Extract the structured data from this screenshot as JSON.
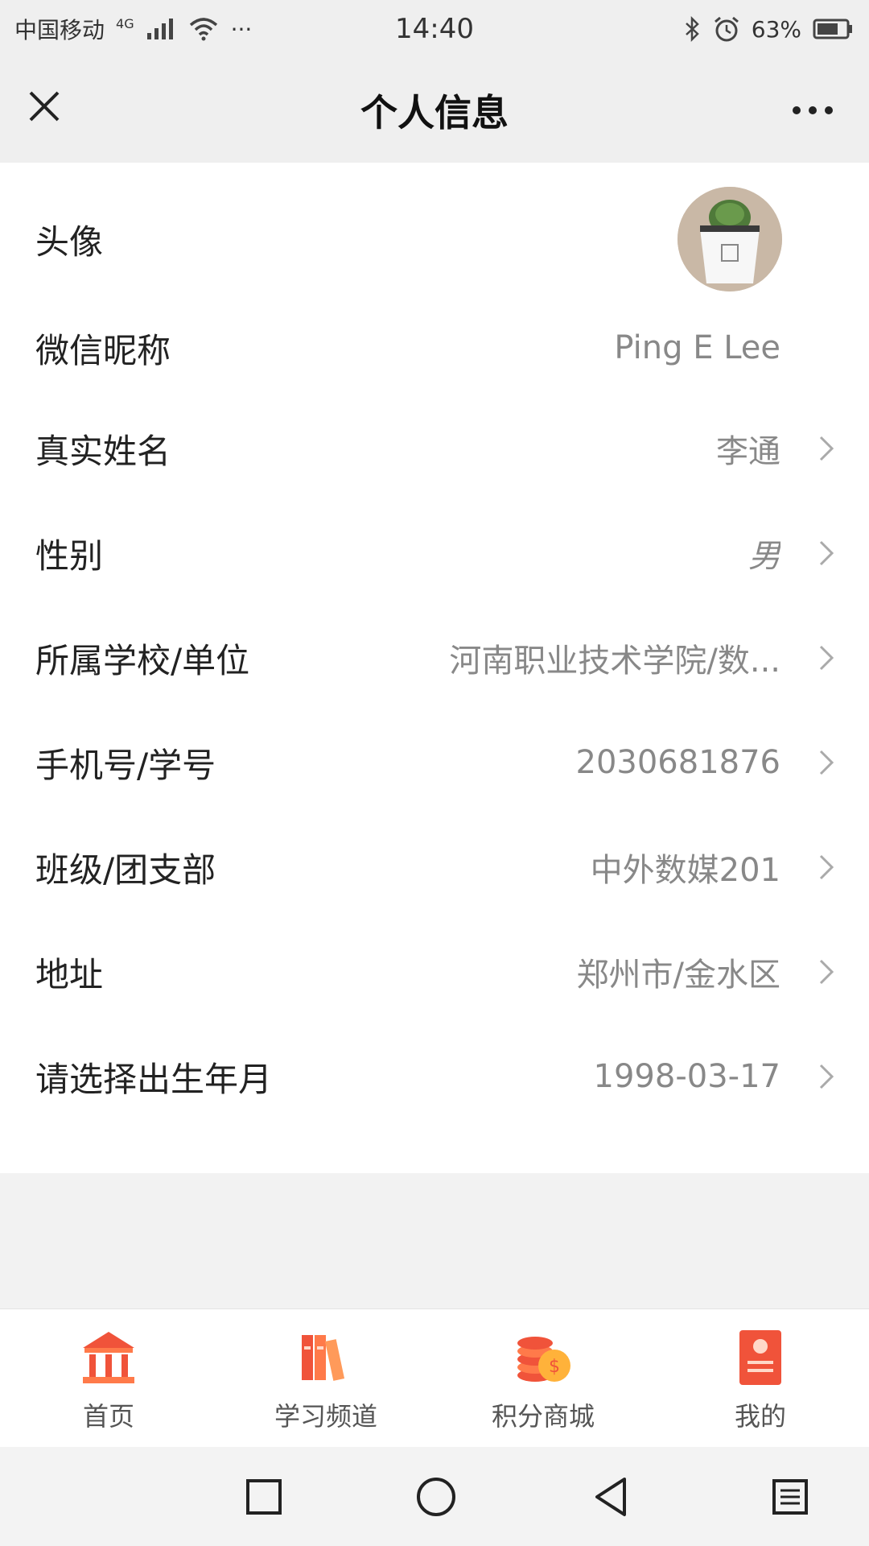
{
  "status": {
    "carrier": "中国移动",
    "network": "4G",
    "more": "···",
    "time": "14:40",
    "battery": "63%"
  },
  "nav": {
    "title": "个人信息"
  },
  "profile": {
    "avatar_label": "头像",
    "rows": [
      {
        "label": "微信昵称",
        "value": "Ping E Lee"
      },
      {
        "label": "真实姓名",
        "value": "李通"
      },
      {
        "label": "性别",
        "value": "男"
      },
      {
        "label": "所属学校/单位",
        "value": "河南职业技术学院/数..."
      },
      {
        "label": "手机号/学号",
        "value": "2030681876"
      },
      {
        "label": "班级/团支部",
        "value": "中外数媒201"
      },
      {
        "label": "地址",
        "value": "郑州市/金水区"
      },
      {
        "label": "请选择出生年月",
        "value": "1998-03-17"
      }
    ]
  },
  "tabs": [
    {
      "label": "首页",
      "icon": "home-icon"
    },
    {
      "label": "学习频道",
      "icon": "books-icon"
    },
    {
      "label": "积分商城",
      "icon": "coins-icon"
    },
    {
      "label": "我的",
      "icon": "profile-card-icon"
    }
  ],
  "colors": {
    "accent": "#f0533a",
    "accent_light": "#ff9a5a"
  }
}
